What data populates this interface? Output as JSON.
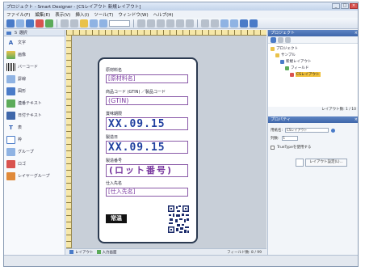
{
  "window": {
    "title": "プロジェクト - Smart Designer - [CSレイアウト 新規レイアウト]",
    "controls": [
      "_",
      "□",
      "×"
    ]
  },
  "menu": {
    "items": [
      "ファイル(F)",
      "編集(E)",
      "表示(V)",
      "挿入(I)",
      "ツール(T)",
      "ウィンドウ(W)",
      "ヘルプ(H)"
    ]
  },
  "tools": {
    "header": "Ｓ 選択",
    "items": [
      {
        "label": "文字",
        "icon": "text-icon",
        "glyph": "A"
      },
      {
        "label": "画像",
        "icon": "image-icon",
        "glyph": ""
      },
      {
        "label": "バーコード",
        "icon": "barcode-icon",
        "glyph": ""
      },
      {
        "label": "罫線",
        "icon": "line-icon",
        "glyph": ""
      },
      {
        "label": "図形",
        "icon": "shape-icon",
        "glyph": ""
      },
      {
        "label": "連番テキスト",
        "icon": "serial-text-icon",
        "glyph": ""
      },
      {
        "label": "日付テキスト",
        "icon": "date-text-icon",
        "glyph": ""
      },
      {
        "label": "表",
        "icon": "table-icon",
        "glyph": "T"
      },
      {
        "label": "枠",
        "icon": "frame-icon",
        "glyph": ""
      },
      {
        "label": "グループ",
        "icon": "group-icon",
        "glyph": ""
      },
      {
        "label": "ロゴ",
        "icon": "logo-icon",
        "glyph": ""
      },
      {
        "label": "レイヤーグループ",
        "icon": "layer-group-icon",
        "glyph": ""
      }
    ]
  },
  "label": {
    "field1_caption": "原材料名",
    "field1_value": "[原材料名]",
    "field2_caption": "商品コード (GTIN) ／製品コード",
    "field2_value": "(GTIN)",
    "field3_caption": "賞味期限",
    "field3_value": "XX.09.15",
    "field4_caption": "製造日",
    "field4_value": "XX.09.15",
    "field5_caption": "製造番号",
    "field5_value": "(ロット番号)",
    "field6_caption": "仕入先名",
    "field6_value": "[仕入先名]",
    "stamp": "常温"
  },
  "project_panel": {
    "title": "プロジェクト",
    "tree": [
      "プロジェクト",
      "サンプル",
      "新規レイアウト",
      "フィールド",
      "CSレイアウト"
    ],
    "status": "レイアウト数: 1 / 10"
  },
  "property_panel": {
    "title": "プロパティ",
    "row1_label": "用紙名:",
    "row1_value": "CSレイアウト",
    "row2_label": "列数:",
    "row2_value": "1",
    "checkbox_label": "TrueTypeを使用する",
    "button_label": "レイアウト設定(L)..."
  },
  "bottom": {
    "tabs": [
      "レイアウト",
      "入力画面"
    ],
    "status": "フィールド数: 8 / 99"
  },
  "colors": {
    "accent": "#4a7bc8",
    "field_border": "#8a5aa8",
    "value_text": "#2040a0"
  }
}
